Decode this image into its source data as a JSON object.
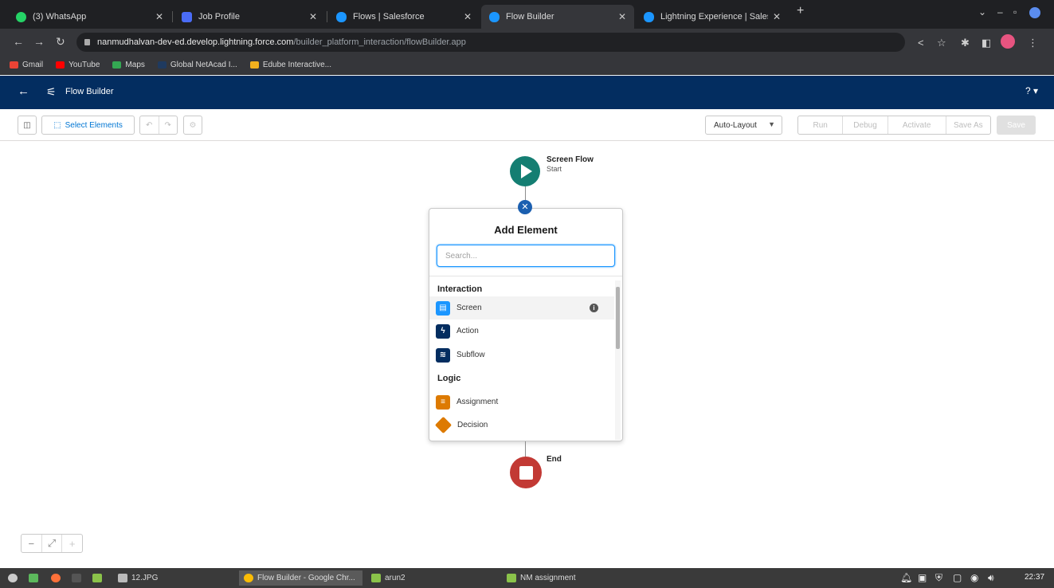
{
  "browser": {
    "tabs": [
      {
        "title": "(3) WhatsApp",
        "favicon_color": "#25d366",
        "active": false
      },
      {
        "title": "Job Profile",
        "favicon_color": "#4a6cf7",
        "active": false
      },
      {
        "title": "Flows | Salesforce",
        "favicon_color": "#1b96ff",
        "active": false
      },
      {
        "title": "Flow Builder",
        "favicon_color": "#1b96ff",
        "active": true
      },
      {
        "title": "Lightning Experience | Sales",
        "favicon_color": "#1b96ff",
        "active": false
      }
    ],
    "url_host": "nanmudhalvan-dev-ed.develop.lightning.force.com",
    "url_path": "/builder_platform_interaction/flowBuilder.app",
    "bookmarks": [
      {
        "label": "Gmail",
        "color": "#ea4335"
      },
      {
        "label": "YouTube",
        "color": "#ff0000"
      },
      {
        "label": "Maps",
        "color": "#34a853"
      },
      {
        "label": "Global NetAcad I...",
        "color": "#1f3a5f"
      },
      {
        "label": "Edube Interactive...",
        "color": "#f2b01e"
      }
    ]
  },
  "app_header": {
    "title": "Flow Builder",
    "help": "? ▾"
  },
  "toolbar": {
    "select_elements": "Select Elements",
    "layout_mode": "Auto-Layout",
    "run": "Run",
    "debug": "Debug",
    "activate": "Activate",
    "save_as": "Save As",
    "save": "Save"
  },
  "canvas": {
    "start": {
      "title": "Screen Flow",
      "subtitle": "Start"
    },
    "end": {
      "title": "End"
    }
  },
  "add_element": {
    "title": "Add Element",
    "search_placeholder": "Search...",
    "sections": [
      {
        "header": "Interaction",
        "items": [
          {
            "label": "Screen",
            "icon": "screen-icon",
            "color": "#1b96ff"
          },
          {
            "label": "Action",
            "icon": "action-icon",
            "color": "#032d60"
          },
          {
            "label": "Subflow",
            "icon": "subflow-icon",
            "color": "#032d60"
          }
        ]
      },
      {
        "header": "Logic",
        "items": [
          {
            "label": "Assignment",
            "icon": "assignment-icon",
            "color": "#dd7a01"
          },
          {
            "label": "Decision",
            "icon": "decision-icon",
            "color": "#dd7a01"
          }
        ]
      }
    ]
  },
  "taskbar": {
    "items": [
      "12.JPG",
      "Flow Builder - Google Chr...",
      "arun2",
      "NM assignment"
    ],
    "clock": "22:37"
  }
}
